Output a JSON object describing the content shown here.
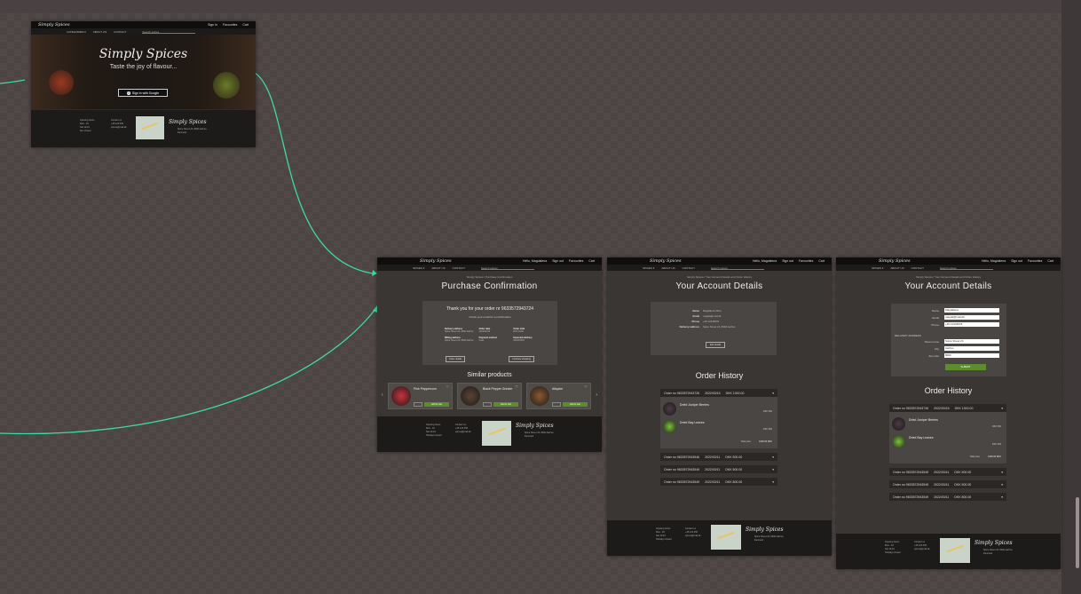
{
  "common": {
    "brand": "Simply Spices",
    "nav": {
      "categories": "SPICES ▾",
      "about": "ABOUT US",
      "contact": "CONTACT",
      "search_placeholder": "Search spices"
    },
    "top_guest": {
      "sign_in": "Sign In",
      "favourites": "Favourites",
      "cart": "Cart"
    },
    "top_user": {
      "hello": "Hello, Magdalena",
      "sign_out": "Sign out",
      "favourites": "Favourites",
      "cart": "Cart"
    },
    "footer": {
      "col1_title": "Opening hours",
      "col1_lines": [
        "Mon - Fri",
        "Sat 10-16",
        "Sun closed",
        "Holidays closed"
      ],
      "col2_title": "Contact us",
      "phone": "+45 123 456",
      "email": "spices@mail.dk",
      "address": "Spice Street 24, 8000 Aarhus, Denmark"
    }
  },
  "frame_login": {
    "nav": {
      "categories": "CATEGORIES ▾",
      "about": "ABOUT US",
      "contact": "CONTACT",
      "search_placeholder": "Search spices"
    },
    "hero_title": "Simply Spices",
    "hero_subtitle": "Taste the joy of flavour...",
    "google_button": "Sign in with Google"
  },
  "frame_confirm": {
    "breadcrumb": "Simply Spices / Purchase Confirmation",
    "title": "Purchase Confirmation",
    "thank_you": "Thank you for your order nr 9633572943724",
    "check_email": "Check your email for a confirmation",
    "details": [
      {
        "label": "Delivery address",
        "value": "Spice Street 24, 8000 Aarhus"
      },
      {
        "label": "Order date",
        "value": "2022/03/15"
      },
      {
        "label": "Order total",
        "value": "DKK 1000"
      },
      {
        "label": "Billing address",
        "value": "Spice Street 24, 8000 Aarhus"
      },
      {
        "label": "Payment method",
        "value": "Card"
      },
      {
        "label": "Expected delivery",
        "value": "2022/03/18"
      }
    ],
    "btn_left": "Order details",
    "btn_right": "Continue shopping",
    "similar_title": "Similar products",
    "products": [
      {
        "name": "Pink Peppercorn",
        "button": "Add to cart",
        "color": "#c8323c"
      },
      {
        "name": "Black Pepper Grinder",
        "button": "Add to cart",
        "color": "#5a4436"
      },
      {
        "name": "Allspice",
        "button": "Add to cart",
        "color": "#8a5a32"
      }
    ]
  },
  "frame_account": {
    "breadcrumb": "Simply Spices / Your Account Details and Order History",
    "title": "Your Account Details",
    "fields": [
      {
        "label": "Name",
        "value": "Magdalena Wow"
      },
      {
        "label": "Email",
        "value": "magda@mail.dk"
      },
      {
        "label": "Phone",
        "value": "+45 12345678"
      },
      {
        "label": "Delivery address",
        "value": "Spice Street 24, 8000 Aarhus"
      }
    ],
    "edit_button": "Edit details",
    "history_title": "Order History",
    "orders": [
      {
        "no": "Order no 9633572943726",
        "date": "2022/03/15",
        "total": "DKK 1000.00"
      },
      {
        "no": "Order no 9633572943546",
        "date": "2022/03/11",
        "total": "DKK 500.00"
      },
      {
        "no": "Order no 9633572943549",
        "date": "2022/03/11",
        "total": "DKK 500.00"
      },
      {
        "no": "Order no 9633572943549",
        "date": "2022/03/11",
        "total": "DKK 800.00"
      }
    ],
    "order_items": [
      {
        "name": "Dried Juniper Berries",
        "price": "DKK 500",
        "color": "#4a3a44"
      },
      {
        "name": "Dried Bay Leaves",
        "price": "DKK 500",
        "color": "#7bc23a"
      }
    ],
    "total_label": "Total price",
    "total_value": "1000.00 DKK"
  },
  "frame_edit": {
    "breadcrumb": "Simply Spices / Your Account Details and Order History",
    "title": "Your Account Details",
    "fields": [
      {
        "label": "Name",
        "value": "Magdalena"
      },
      {
        "label": "Email",
        "value": "magda@mail.dk"
      },
      {
        "label": "Phone",
        "value": "+45 12345678"
      }
    ],
    "address_heading": "DELIVERY ADDRESS",
    "address_fields": [
      {
        "label": "Street name",
        "value": "Spice Street 24"
      },
      {
        "label": "City",
        "value": "Aarhus"
      },
      {
        "label": "Zip code",
        "value": "8000"
      }
    ],
    "submit": "SUBMIT",
    "history_title": "Order History",
    "orders": [
      {
        "no": "Order no 9633572943726",
        "date": "2022/03/15",
        "total": "DKK 1000.00"
      },
      {
        "no": "Order no 9633572943549",
        "date": "2022/03/11",
        "total": "DKK 500.00"
      },
      {
        "no": "Order no 9633572943549",
        "date": "2022/03/11",
        "total": "DKK 500.00"
      },
      {
        "no": "Order no 9633572943549",
        "date": "2022/03/11",
        "total": "DKK 800.00"
      }
    ],
    "order_items": [
      {
        "name": "Dried Juniper Berries",
        "price": "DKK 500",
        "color": "#4a3a44"
      },
      {
        "name": "Dried Bay Leaves",
        "price": "DKK 500",
        "color": "#7bc23a"
      }
    ],
    "total_label": "Total price",
    "total_value": "1000.00 DKK"
  },
  "colors": {
    "flow": "#3ed9a8",
    "accent_green": "#5b8d2d"
  }
}
